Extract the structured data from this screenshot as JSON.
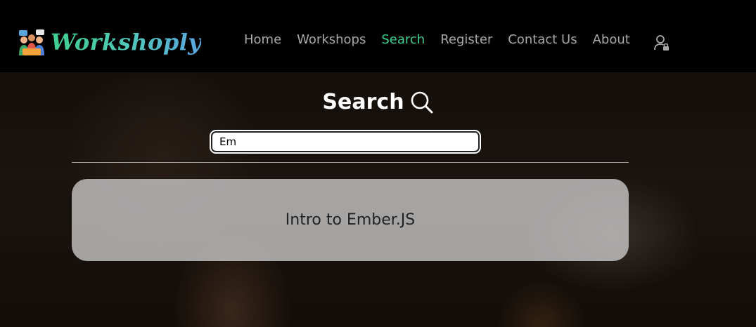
{
  "brand": {
    "name": "Workshoply",
    "logo_icon": "team-logo-icon"
  },
  "nav": {
    "items": [
      {
        "label": "Home",
        "active": false
      },
      {
        "label": "Workshops",
        "active": false
      },
      {
        "label": "Search",
        "active": true
      },
      {
        "label": "Register",
        "active": false
      },
      {
        "label": "Contact Us",
        "active": false
      },
      {
        "label": "About",
        "active": false
      }
    ],
    "user_icon": "user-lock-icon"
  },
  "search": {
    "title": "Search",
    "title_icon": "magnifier-icon",
    "input_value": "Em"
  },
  "results": [
    {
      "title": "Intro to Ember.JS"
    }
  ],
  "colors": {
    "accent": "#3fcf8e",
    "nav_text": "#a8a8a8",
    "header_bg": "#000000",
    "card_bg": "#cdcdcd"
  }
}
